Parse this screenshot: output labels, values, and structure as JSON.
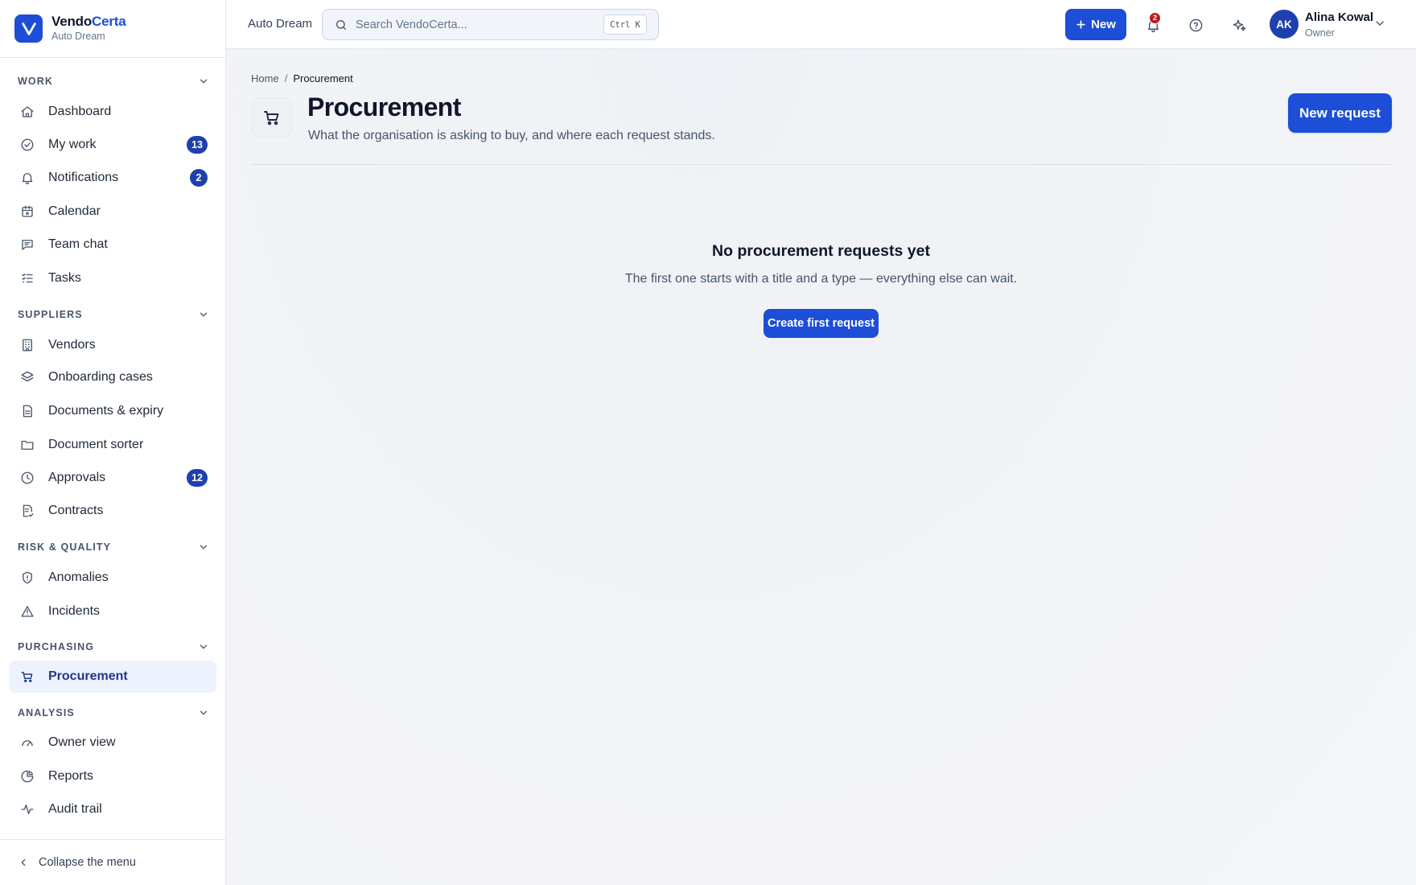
{
  "brand": {
    "name_part1": "Vendo",
    "name_part2": "Certa",
    "org": "Auto Dream",
    "logo_icon": "check-logo-icon",
    "accent_color": "#1d4ed8"
  },
  "sidebar": {
    "sections": [
      {
        "title": "WORK",
        "items": [
          {
            "label": "Dashboard",
            "icon": "home-icon"
          },
          {
            "label": "My work",
            "icon": "check-circle-icon",
            "badge": "13"
          },
          {
            "label": "Notifications",
            "icon": "bell-icon",
            "badge": "2"
          },
          {
            "label": "Calendar",
            "icon": "calendar-icon"
          },
          {
            "label": "Team chat",
            "icon": "chat-icon"
          },
          {
            "label": "Tasks",
            "icon": "checklist-icon"
          }
        ]
      },
      {
        "title": "SUPPLIERS",
        "items": [
          {
            "label": "Vendors",
            "icon": "building-icon"
          },
          {
            "label": "Onboarding cases",
            "icon": "layers-icon"
          },
          {
            "label": "Documents & expiry",
            "icon": "document-icon"
          },
          {
            "label": "Document sorter",
            "icon": "folder-icon"
          },
          {
            "label": "Approvals",
            "icon": "clock-icon",
            "badge": "12"
          },
          {
            "label": "Contracts",
            "icon": "contract-icon"
          }
        ]
      },
      {
        "title": "RISK & QUALITY",
        "items": [
          {
            "label": "Anomalies",
            "icon": "shield-icon"
          },
          {
            "label": "Incidents",
            "icon": "warning-icon"
          }
        ]
      },
      {
        "title": "PURCHASING",
        "items": [
          {
            "label": "Procurement",
            "icon": "cart-icon",
            "active": true
          }
        ]
      },
      {
        "title": "ANALYSIS",
        "items": [
          {
            "label": "Owner view",
            "icon": "gauge-icon"
          },
          {
            "label": "Reports",
            "icon": "pie-icon"
          },
          {
            "label": "Audit trail",
            "icon": "activity-icon"
          }
        ]
      }
    ],
    "collapse_label": "Collapse the menu"
  },
  "topbar": {
    "org": "Auto Dream",
    "search_placeholder": "Search VendoCerta...",
    "search_shortcut": "Ctrl K",
    "new_label": "New",
    "notification_count": "2",
    "user": {
      "initials": "AK",
      "name": "Alina Kowal",
      "role": "Owner"
    }
  },
  "page": {
    "breadcrumb": {
      "home": "Home",
      "separator": "/",
      "current": "Procurement"
    },
    "title": "Procurement",
    "subtitle": "What the organisation is asking to buy, and where each request stands.",
    "new_request_label": "New request",
    "empty": {
      "title": "No procurement requests yet",
      "description": "The first one starts with a title and a type — everything else can wait.",
      "cta": "Create first request"
    }
  }
}
